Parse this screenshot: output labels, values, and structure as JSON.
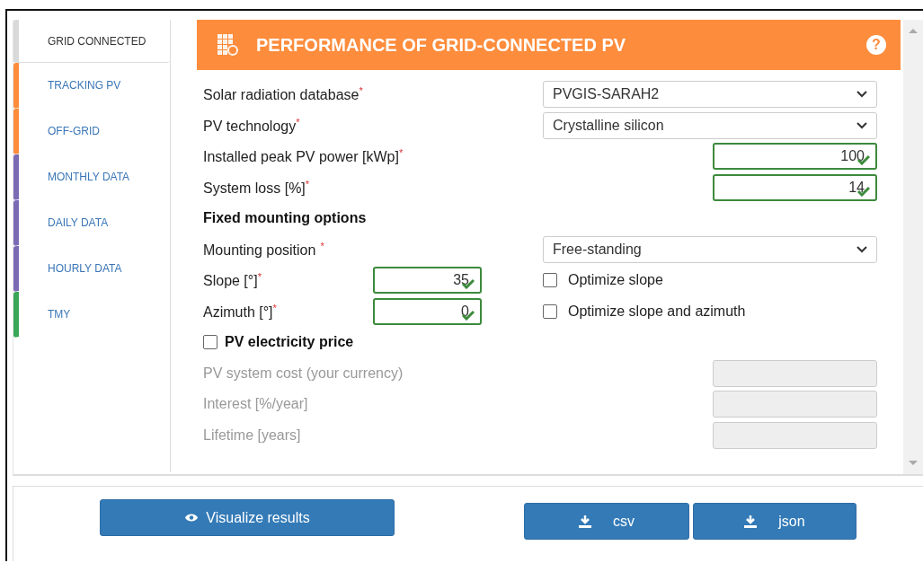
{
  "tabs": [
    {
      "label": "GRID CONNECTED",
      "selected": true,
      "color": "#d9d9d9"
    },
    {
      "label": "TRACKING PV",
      "selected": false,
      "color": "#fd8c3c"
    },
    {
      "label": "OFF-GRID",
      "selected": false,
      "color": "#fd8c3c"
    },
    {
      "label": "MONTHLY DATA",
      "selected": false,
      "color": "#7b6bb5"
    },
    {
      "label": "DAILY DATA",
      "selected": false,
      "color": "#7b6bb5"
    },
    {
      "label": "HOURLY DATA",
      "selected": false,
      "color": "#7b6bb5"
    },
    {
      "label": "TMY",
      "selected": false,
      "color": "#3aa858"
    }
  ],
  "header": {
    "title": "PERFORMANCE OF GRID-CONNECTED PV",
    "help": "?"
  },
  "rows": [
    {
      "kind": "select",
      "label": "Solar radiation database",
      "mark": "*",
      "value": "PVGIS-SARAH2"
    },
    {
      "kind": "select",
      "label": "PV technology",
      "mark": "*",
      "value": "Crystalline silicon"
    },
    {
      "kind": "number",
      "label": "Installed peak PV power [kWp]",
      "mark": "*",
      "value": "100",
      "valid": true,
      "disabled": false
    },
    {
      "kind": "number",
      "label": "System loss [%]",
      "mark": "*",
      "value": "14",
      "valid": true,
      "disabled": false
    },
    {
      "kind": "heading",
      "label": "Fixed mounting options"
    },
    {
      "kind": "select",
      "label": "Mounting position",
      "mark": "*",
      "value": "Free-standing"
    },
    {
      "kind": "angle",
      "label": "Slope [°]",
      "mark": "*",
      "value": "35",
      "valid": true,
      "option": "Optimize slope",
      "checked": false
    },
    {
      "kind": "angle",
      "label": "Azimuth [°]",
      "mark": "*",
      "value": "0",
      "valid": true,
      "option": "Optimize slope and azimuth",
      "checked": false
    },
    {
      "kind": "check",
      "label": "PV electricity price",
      "checked": false
    },
    {
      "kind": "number",
      "label": "PV system cost (your currency)",
      "valid": false,
      "disabled": true
    },
    {
      "kind": "number",
      "label": "Interest [%/year]",
      "valid": false,
      "disabled": true
    },
    {
      "kind": "number",
      "label": "Lifetime [years]",
      "valid": false,
      "disabled": true
    }
  ],
  "actions": {
    "visualize": "Visualize results",
    "downloads": [
      "csv",
      "json"
    ]
  }
}
